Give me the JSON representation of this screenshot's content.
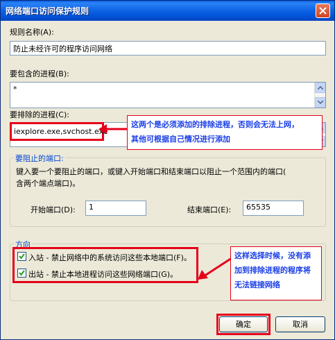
{
  "window": {
    "title": "网络端口访问保护规则"
  },
  "fields": {
    "rule_name_label": "规则名称(A):",
    "rule_name_value": "防止未经许可的程序访问网络",
    "include_label": "要包含的进程(B):",
    "include_value": "*",
    "exclude_label": "要排除的进程(C):",
    "exclude_value": "iexplore.exe,svchost.exe"
  },
  "ports_group": {
    "title": "要阻止的端口:",
    "description_line1": "键入要一个要阻止的端口，或键入开始端口和结束端口以阻止一个范围内的端口(",
    "description_line2": "含两个端点端口)。",
    "start_label": "开始端口(D):",
    "start_value": "1",
    "end_label": "结束端口(E):",
    "end_value": "65535"
  },
  "direction_group": {
    "title": "方向",
    "inbound_label": "入站 - 禁止网络中的系统访问这些本地端口(F)。",
    "inbound_checked": true,
    "outbound_label": "出站 - 禁止本地进程访问这些网络端口(G)。",
    "outbound_checked": true
  },
  "annotations": {
    "exclude_note_line1": "这两个是必须添加的排除进程，否则会无法上网，",
    "exclude_note_line2": "其他可根据自己情况进行添加",
    "direction_note_line1": "这样选择时候，没有添",
    "direction_note_line2": "加到排除进程的程序将",
    "direction_note_line3": "无法链接网络",
    "highlight_color": "#e5001a",
    "note_text_color": "#1a3ee8"
  },
  "buttons": {
    "ok": "确定",
    "cancel": "取消"
  },
  "colors": {
    "titlebar": "#0052d6",
    "dialog_bg": "#ece9d8",
    "group_title": "#0046d5"
  }
}
